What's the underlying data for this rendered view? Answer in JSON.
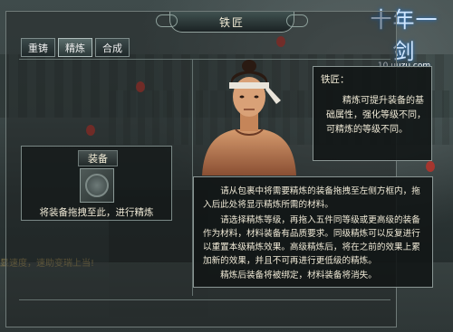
{
  "window": {
    "title": "铁匠",
    "tabs": [
      {
        "label": "重铸",
        "active": false
      },
      {
        "label": "精炼",
        "active": true
      },
      {
        "label": "合成",
        "active": false
      }
    ]
  },
  "equip_panel": {
    "label": "装备",
    "hint": "将装备拖拽至此，进行精炼"
  },
  "npc": {
    "name": "铁匠：",
    "speech": "精炼可提升装备的基础属性，强化等级不同，可精炼的等级不同。"
  },
  "instructions": [
    "请从包裹中将需要精炼的装备拖拽至左侧方框内，拖入后此处将显示精炼所需的材料。",
    "请选择精炼等级，再拖入五件同等级或更高级的装备作为材料，材料装备有品质要求。同级精炼可以反复进行以重置本级精炼效果。高级精炼后，将在之前的效果上累加新的效果，并且不可再进行更低级的精炼。",
    "精炼后装备将被绑定，材料装备将消失。"
  ],
  "logo": {
    "main": "十年一剑",
    "url": "10.uuzu.com"
  },
  "background_chat": {
    "line1": "显速度，速助变瑞上当!"
  },
  "colors": {
    "accent": "#8a9694",
    "text": "#efe9d6",
    "lantern": "#b8322a"
  }
}
